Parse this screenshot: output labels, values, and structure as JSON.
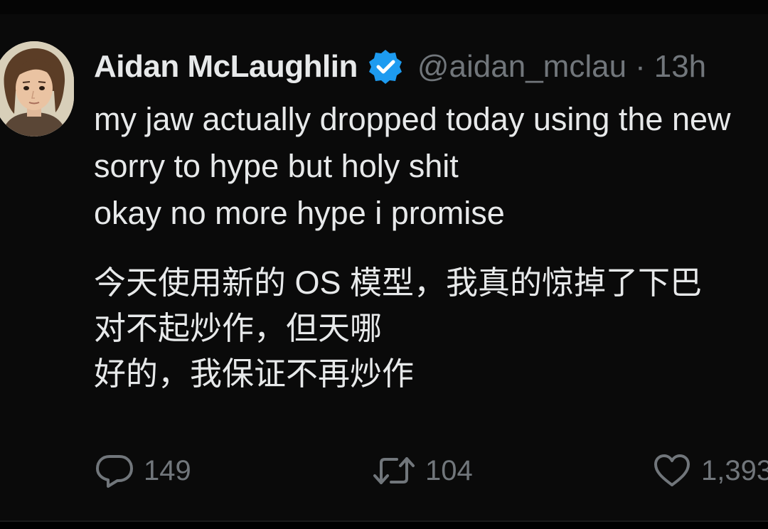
{
  "tweet": {
    "author_name": "Aidan McLaughlin",
    "handle": "@aidan_mclau",
    "separator": "·",
    "time": "13h",
    "english_lines": [
      "my jaw actually dropped today using the new",
      "sorry to hype but holy shit",
      "okay no more hype i promise"
    ],
    "chinese_lines": [
      "今天使用新的 OS 模型，我真的惊掉了下巴",
      "对不起炒作，但天哪",
      "好的，我保证不再炒作"
    ]
  },
  "actions": {
    "reply_count": "149",
    "retweet_count": "104",
    "like_count": "1,393"
  },
  "colors": {
    "background": "#0a0a0a",
    "text": "#e7e9ea",
    "muted": "#71767b",
    "verified": "#1d9bf0"
  },
  "icons": [
    "verified-badge-icon",
    "reply-icon",
    "retweet-icon",
    "like-icon"
  ]
}
